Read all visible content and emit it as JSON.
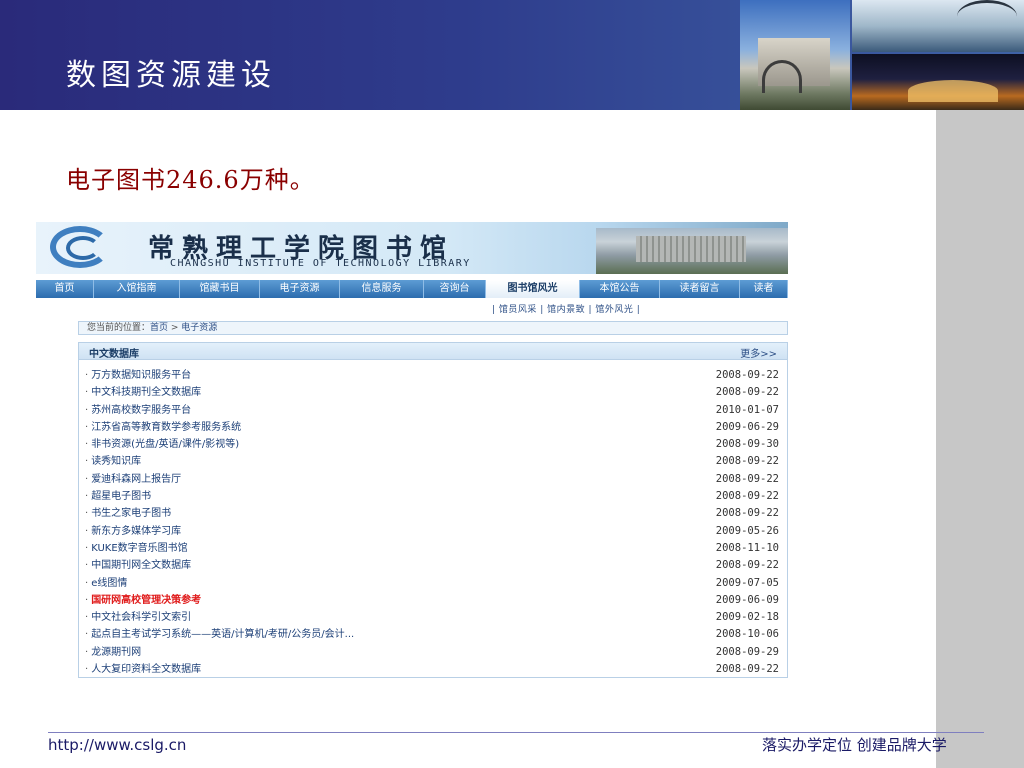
{
  "slide": {
    "title": "数图资源建设",
    "subtitle": "电子图书246.6万种。"
  },
  "library_site": {
    "name_cn": "常熟理工学院图书馆",
    "name_en": "CHANGSHU INSTITUTE OF TECHNOLOGY LIBRARY",
    "nav": [
      {
        "label": "首页"
      },
      {
        "label": "入馆指南"
      },
      {
        "label": "馆藏书目"
      },
      {
        "label": "电子资源"
      },
      {
        "label": "信息服务"
      },
      {
        "label": "咨询台"
      },
      {
        "label": "图书馆风光"
      },
      {
        "label": "本馆公告"
      },
      {
        "label": "读者留言"
      },
      {
        "label": "读者"
      }
    ],
    "active_nav": "图书馆风光",
    "subnav": "| 馆员风采  | 馆内景致  | 馆外风光  |",
    "breadcrumb": {
      "prefix": "您当前的位置：",
      "home": "首页",
      "sep": " > ",
      "current": "电子资源"
    },
    "db_panel": {
      "title": "中文数据库",
      "more": "更多>>",
      "items": [
        {
          "name": "万方数据知识服务平台",
          "date": "2008-09-22"
        },
        {
          "name": "中文科技期刊全文数据库",
          "date": "2008-09-22"
        },
        {
          "name": "苏州高校数字服务平台",
          "date": "2010-01-07"
        },
        {
          "name": "江苏省高等教育数学参考服务系统",
          "date": "2009-06-29"
        },
        {
          "name": "非书资源(光盘/英语/课件/影视等)",
          "date": "2008-09-30"
        },
        {
          "name": "读秀知识库",
          "date": "2008-09-22"
        },
        {
          "name": "爱迪科森网上报告厅",
          "date": "2008-09-22"
        },
        {
          "name": "超星电子图书",
          "date": "2008-09-22"
        },
        {
          "name": "书生之家电子图书",
          "date": "2008-09-22"
        },
        {
          "name": "新东方多媒体学习库",
          "date": "2009-05-26"
        },
        {
          "name": "KUKE数字音乐图书馆",
          "date": "2008-11-10"
        },
        {
          "name": "中国期刊网全文数据库",
          "date": "2008-09-22"
        },
        {
          "name": "e线图情",
          "date": "2009-07-05"
        },
        {
          "name": "国研网高校管理决策参考",
          "date": "2009-06-09"
        },
        {
          "name": "中文社会科学引文索引",
          "date": "2009-02-18"
        },
        {
          "name": "起点自主考试学习系统——英语/计算机/考研/公务员/会计...",
          "date": "2008-10-06"
        },
        {
          "name": "龙源期刊网",
          "date": "2008-09-29"
        },
        {
          "name": "人大复印资料全文数据库",
          "date": "2008-09-22"
        }
      ],
      "highlight_color": "#e01c1c"
    }
  },
  "footer": {
    "url": "http://www.cslg.cn",
    "slogan": "落实办学定位 创建品牌大学"
  },
  "colors": {
    "header_bg": "#2e3c8c",
    "subtitle": "#8a0000",
    "nav_bg": "#2c6cae",
    "footer_text": "#1a1a66"
  }
}
